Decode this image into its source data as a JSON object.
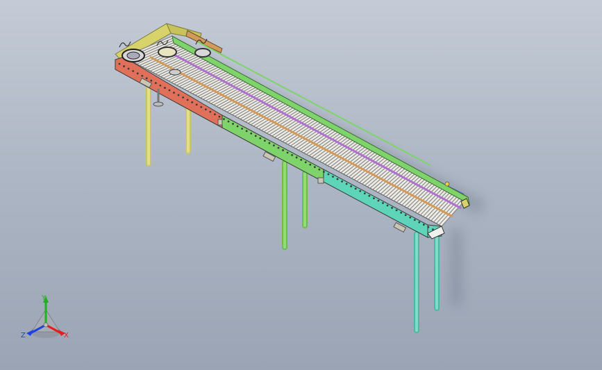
{
  "viewport": {
    "background_top": "#c4cbd6",
    "background_bottom": "#9aa4b4"
  },
  "model": {
    "description_icon": "roller-conveyor-3d-model",
    "colors": {
      "frame_red": "#e0705a",
      "frame_green": "#7ed46a",
      "frame_teal": "#5ed4b8",
      "frame_yellow": "#d8d26a",
      "rail_purple": "#b070d0",
      "rail_orange": "#d49a5a",
      "roller": "#f2f2f0",
      "leg_yellow": "#d6d27a",
      "leg_green": "#7ccc5e",
      "leg_teal": "#5ccab6"
    }
  },
  "triad": {
    "x_label": "X",
    "y_label": "Y",
    "z_label": "Z",
    "x_color": "#e02020",
    "y_color": "#20b020",
    "z_color": "#2040e0"
  }
}
